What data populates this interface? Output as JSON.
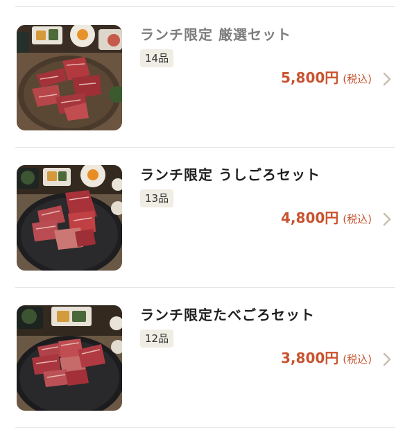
{
  "menu": {
    "items": [
      {
        "title": "ランチ限定 厳選セット",
        "count": "14品",
        "price": "5,800円",
        "tax_note": "(税込)",
        "plate_icon": "wooden-plate-beef-photo"
      },
      {
        "title": "ランチ限定 うしごろセット",
        "count": "13品",
        "price": "4,800円",
        "tax_note": "(税込)",
        "plate_icon": "stone-plate-beef-photo"
      },
      {
        "title": "ランチ限定たべごろセット",
        "count": "12品",
        "price": "3,800円",
        "tax_note": "(税込)",
        "plate_icon": "stone-plate-beef-photo"
      }
    ]
  },
  "colors": {
    "price": "#c9522e",
    "badge_bg": "#efede4",
    "chevron": "#c8bfae",
    "divider": "#e6e6e6"
  },
  "icons": {
    "chevron": "chevron-right-icon"
  }
}
